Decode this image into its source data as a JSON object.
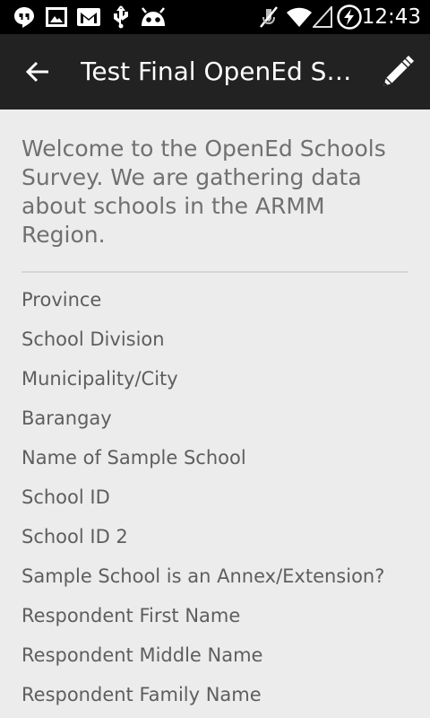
{
  "status_bar": {
    "time": "12:43",
    "icons": [
      "hangouts-icon",
      "image-icon",
      "gmail-icon",
      "usb-icon",
      "android-debug-icon",
      "mute-icon",
      "wifi-icon",
      "signal-icon",
      "battery-charging-icon"
    ]
  },
  "action_bar": {
    "title": "Test Final OpenEd Schools Survey",
    "back_icon": "arrow-back-icon",
    "edit_icon": "pencil-icon"
  },
  "survey": {
    "intro": "Welcome to the OpenEd Schools Survey. We are gathering data about schools in the ARMM Region.",
    "fields": [
      "Province",
      "School Division",
      "Municipality/City",
      "Barangay",
      "Name of Sample School",
      "School ID",
      "School ID 2",
      "Sample School is an Annex/Extension?",
      "Respondent First Name",
      "Respondent Middle Name",
      "Respondent Family Name"
    ]
  },
  "colors": {
    "status_bar_bg": "#000000",
    "action_bar_bg": "#222222",
    "content_bg": "#ececec",
    "text_primary": "#5e5e5e"
  }
}
